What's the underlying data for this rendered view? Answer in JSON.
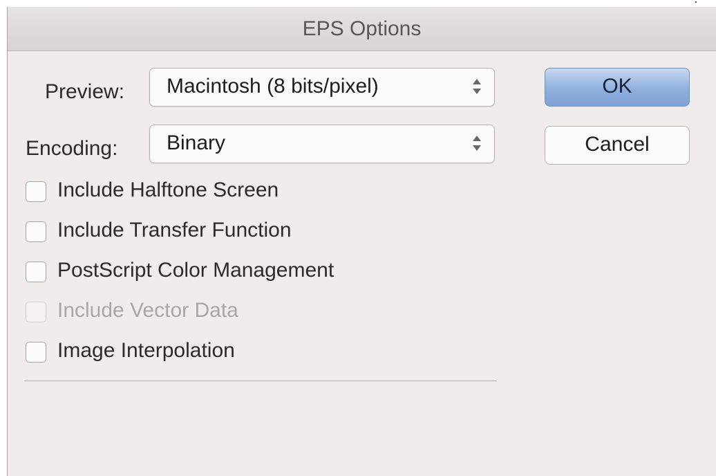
{
  "window": {
    "title": "EPS Options"
  },
  "preview": {
    "label": "Preview:",
    "value": "Macintosh  (8 bits/pixel)"
  },
  "encoding": {
    "label": "Encoding:",
    "value": "Binary"
  },
  "buttons": {
    "ok": "OK",
    "cancel": "Cancel"
  },
  "options": [
    {
      "label": "Include Halftone Screen",
      "checked": false,
      "enabled": true
    },
    {
      "label": "Include Transfer Function",
      "checked": false,
      "enabled": true
    },
    {
      "label": "PostScript Color Management",
      "checked": false,
      "enabled": true
    },
    {
      "label": "Include Vector Data",
      "checked": false,
      "enabled": false
    },
    {
      "label": "Image Interpolation",
      "checked": false,
      "enabled": true
    }
  ],
  "colors": {
    "default_button": "#8fb0dc",
    "dialog_background": "#f0ecec",
    "disabled_text": "#aaa6a6"
  },
  "icons": {
    "popup_indicator": "up-down-chevron-icon"
  }
}
